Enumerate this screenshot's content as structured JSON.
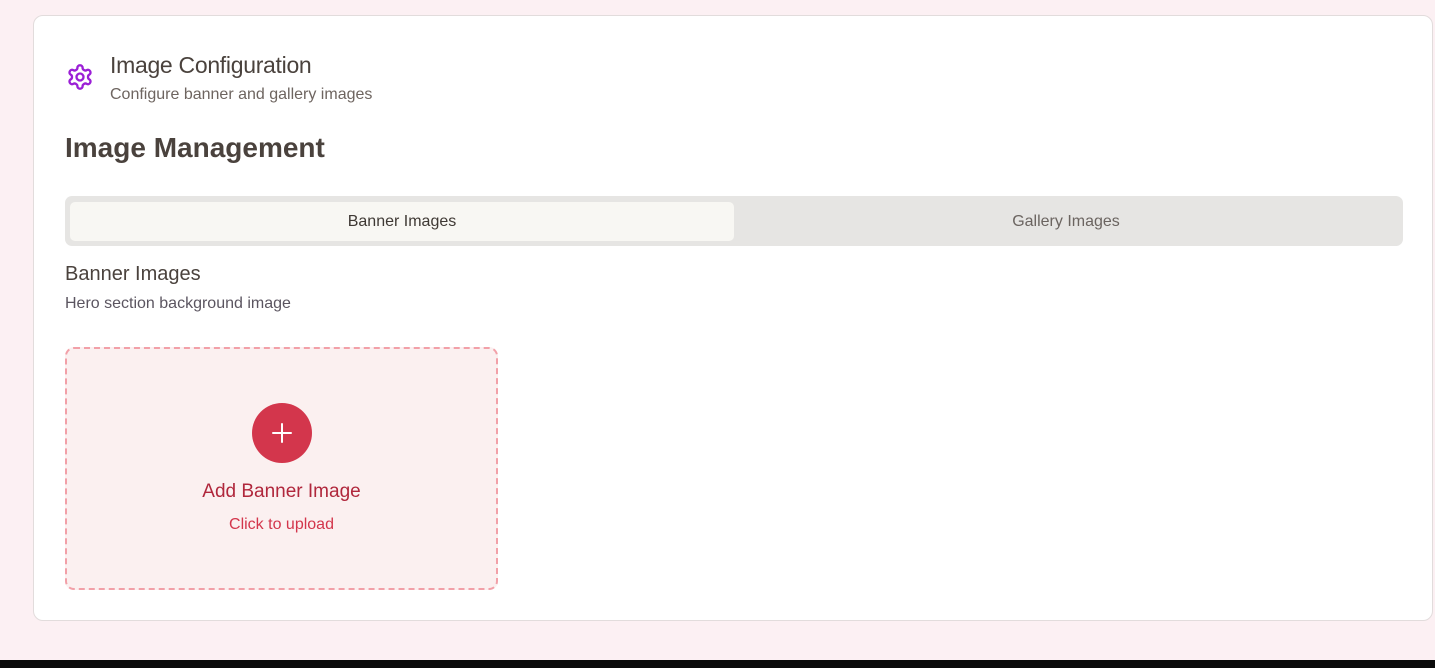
{
  "header": {
    "title": "Image Configuration",
    "subtitle": "Configure banner and gallery images",
    "icon": "gear-icon",
    "icon_color": "#9b1fd6"
  },
  "main": {
    "heading": "Image Management",
    "tabs": [
      {
        "label": "Banner Images",
        "active": true
      },
      {
        "label": "Gallery Images",
        "active": false
      }
    ],
    "section": {
      "title": "Banner Images",
      "description": "Hero section background image"
    },
    "upload": {
      "title": "Add Banner Image",
      "subtitle": "Click to upload",
      "icon": "plus-icon",
      "accent": "#d3364c"
    }
  }
}
